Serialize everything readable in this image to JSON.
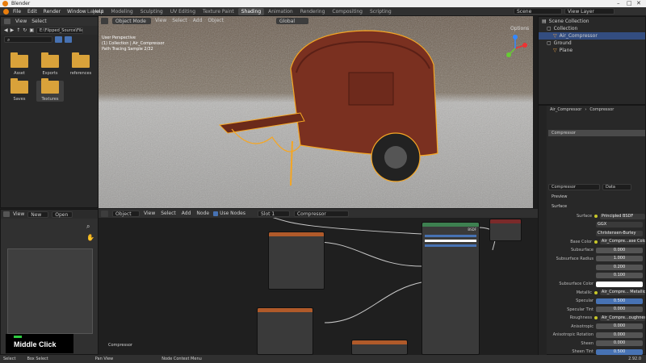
{
  "window": {
    "title": "Blender"
  },
  "menubar": {
    "items": [
      "File",
      "Edit",
      "Render",
      "Window",
      "Help"
    ]
  },
  "workspaces": [
    {
      "label": "Layout",
      "active": false
    },
    {
      "label": "Modeling",
      "active": false
    },
    {
      "label": "Sculpting",
      "active": false
    },
    {
      "label": "UV Editing",
      "active": false
    },
    {
      "label": "Texture Paint",
      "active": false
    },
    {
      "label": "Shading",
      "active": true
    },
    {
      "label": "Animation",
      "active": false
    },
    {
      "label": "Rendering",
      "active": false
    },
    {
      "label": "Compositing",
      "active": false
    },
    {
      "label": "Scripting",
      "active": false
    }
  ],
  "scene": {
    "name": "Scene",
    "view_layer": "View Layer"
  },
  "file_browser": {
    "menu": [
      "View",
      "Select"
    ],
    "path": "E:\\Flipped_Source\\Files",
    "folders": [
      {
        "name": "Asset",
        "selected": false
      },
      {
        "name": "Exports",
        "selected": false
      },
      {
        "name": "references",
        "selected": false
      },
      {
        "name": "Saves",
        "selected": false
      },
      {
        "name": "Textures",
        "selected": true
      }
    ]
  },
  "viewport": {
    "mode": "Object Mode",
    "menu": [
      "View",
      "Select",
      "Add",
      "Object"
    ],
    "transform": "Global",
    "info": [
      "User Perspective",
      "(1) Collection | Air_Compressor",
      "Path Tracing Sample 2/32"
    ],
    "options": "Options"
  },
  "outliner": {
    "root": "Scene Collection",
    "items": [
      {
        "label": "Collection",
        "indent": 0
      },
      {
        "label": "Air_Compressor",
        "indent": 1,
        "selected": true
      },
      {
        "label": "Ground",
        "indent": 0
      },
      {
        "label": "Plane",
        "indent": 1
      }
    ]
  },
  "image_editor": {
    "menu": [
      "View"
    ],
    "new_label": "New",
    "open_label": "Open"
  },
  "node_editor": {
    "object_dropdown": "Object",
    "menu": [
      "View",
      "Select",
      "Add",
      "Node"
    ],
    "use_nodes": "Use Nodes",
    "slot": "Slot 1",
    "material": "Compressor",
    "label": "Compressor",
    "principled_label": "BSDF"
  },
  "properties": {
    "breadcrumb": [
      "Air_Compressor",
      "Compressor"
    ],
    "material_slot": "Compressor",
    "material_name": "Compressor",
    "data_label": "Data",
    "preview": "Preview",
    "surface": "Surface",
    "rows": [
      {
        "label": "Surface",
        "value": "Principled BSDF",
        "kind": "link"
      },
      {
        "label": "",
        "value": "GGX",
        "kind": "drop"
      },
      {
        "label": "",
        "value": "Christensen-Burley",
        "kind": "drop"
      },
      {
        "label": "Base Color",
        "value": "Air_Compre...ase Color.tga",
        "kind": "link"
      },
      {
        "label": "Subsurface",
        "value": "0.000",
        "kind": "num"
      },
      {
        "label": "Subsurface Radius",
        "value": "1.000",
        "kind": "num"
      },
      {
        "label": "",
        "value": "0.200",
        "kind": "num"
      },
      {
        "label": "",
        "value": "0.100",
        "kind": "num"
      },
      {
        "label": "Subsurface Color",
        "value": "",
        "kind": "color"
      },
      {
        "label": "Metallic",
        "value": "Air_Compre... Metallic.tga",
        "kind": "link"
      },
      {
        "label": "Specular",
        "value": "0.500",
        "kind": "blue"
      },
      {
        "label": "Specular Tint",
        "value": "0.000",
        "kind": "num"
      },
      {
        "label": "Roughness",
        "value": "Air_Compre...oughness.tga",
        "kind": "link"
      },
      {
        "label": "Anisotropic",
        "value": "0.000",
        "kind": "num"
      },
      {
        "label": "Anisotropic Rotation",
        "value": "0.000",
        "kind": "num"
      },
      {
        "label": "Sheen",
        "value": "0.000",
        "kind": "num"
      },
      {
        "label": "Sheen Tint",
        "value": "0.500",
        "kind": "blue"
      }
    ]
  },
  "overlay": {
    "key_label": "Middle Click"
  },
  "statusbar": {
    "items": [
      "Select",
      "Box Select",
      "Pan View",
      "Node Context Menu"
    ],
    "version": "2.92.0"
  },
  "colors": {
    "accent": "#e87d0d",
    "active_blue": "#4772b3",
    "selection": "#f5a623"
  }
}
